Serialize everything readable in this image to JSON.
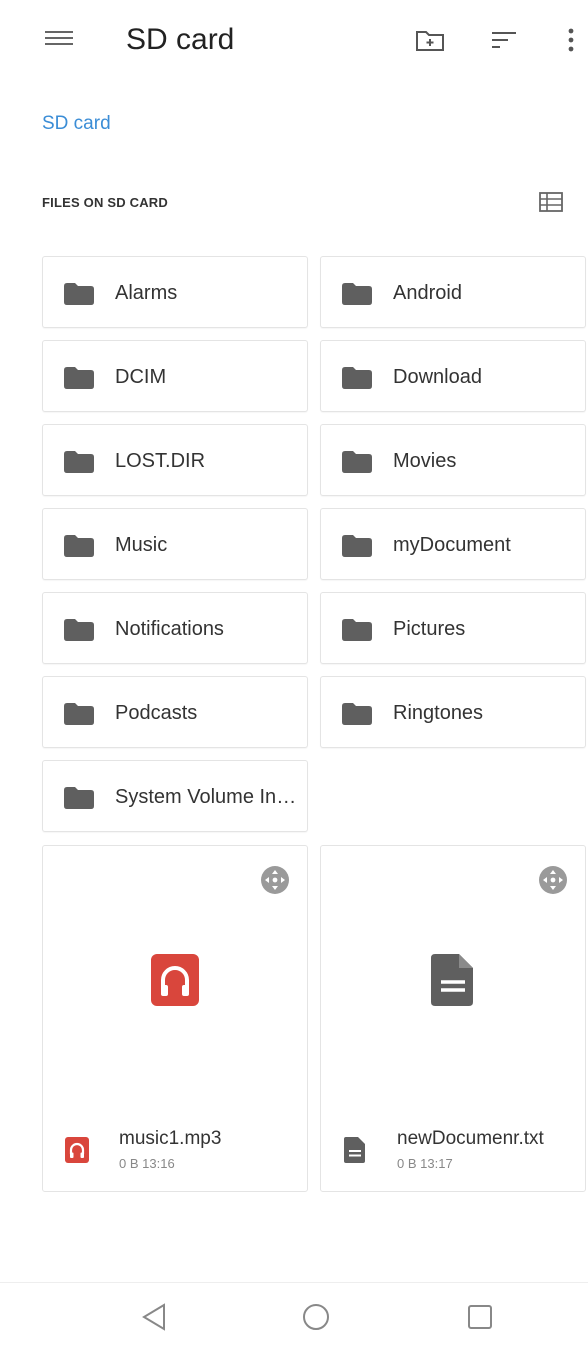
{
  "app_bar": {
    "title": "SD card",
    "icons": [
      "menu-icon",
      "new-folder-icon",
      "sort-icon",
      "more-vert-icon"
    ]
  },
  "breadcrumb": {
    "label": "SD card"
  },
  "section": {
    "header": "FILES ON SD CARD",
    "view_icon": "list-view-icon"
  },
  "folders": [
    {
      "name": "Alarms"
    },
    {
      "name": "Android"
    },
    {
      "name": "DCIM"
    },
    {
      "name": "Download"
    },
    {
      "name": "LOST.DIR"
    },
    {
      "name": "Movies"
    },
    {
      "name": "Music"
    },
    {
      "name": "myDocument"
    },
    {
      "name": "Notifications"
    },
    {
      "name": "Pictures"
    },
    {
      "name": "Podcasts"
    },
    {
      "name": "Ringtones"
    },
    {
      "name": "System Volume Information"
    }
  ],
  "files": [
    {
      "name": "music1.mp3",
      "size": "0 B",
      "time": "13:16",
      "kind": "audio",
      "icon": "headphones-icon"
    },
    {
      "name": "newDocumenr.txt",
      "size": "0 B",
      "time": "13:17",
      "kind": "document",
      "icon": "document-icon"
    }
  ],
  "colors": {
    "accent": "#3b8dd6",
    "audio": "#d9463c",
    "icon_gray": "#5f5f5f"
  },
  "nav": {
    "icons": [
      "back-icon",
      "home-icon",
      "recents-icon"
    ]
  }
}
